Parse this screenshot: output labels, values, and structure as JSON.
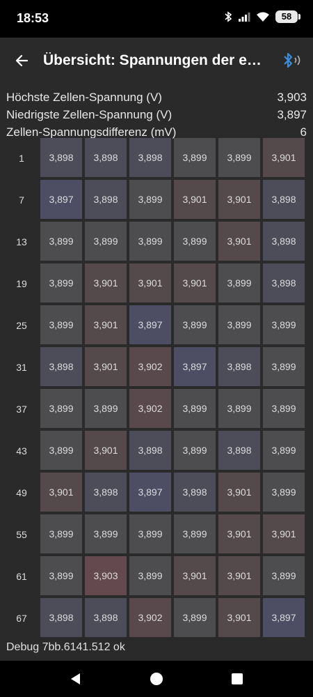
{
  "status_bar": {
    "time": "18:53",
    "battery": "58"
  },
  "app_bar": {
    "title": "Übersicht: Spannungen der e…"
  },
  "summary": [
    {
      "label": "Höchste Zellen-Spannung (V)",
      "value": "3,903"
    },
    {
      "label": "Niedrigste Zellen-Spannung (V)",
      "value": "3,897"
    },
    {
      "label": "Zellen-Spannungsdifferenz (mV)",
      "value": "6"
    }
  ],
  "grid": [
    {
      "label": "1",
      "cells": [
        "3,898",
        "3,898",
        "3,898",
        "3,899",
        "3,899",
        "3,901"
      ]
    },
    {
      "label": "7",
      "cells": [
        "3,897",
        "3,898",
        "3,899",
        "3,901",
        "3,901",
        "3,898"
      ]
    },
    {
      "label": "13",
      "cells": [
        "3,899",
        "3,899",
        "3,899",
        "3,899",
        "3,901",
        "3,898"
      ]
    },
    {
      "label": "19",
      "cells": [
        "3,899",
        "3,901",
        "3,901",
        "3,901",
        "3,899",
        "3,898"
      ]
    },
    {
      "label": "25",
      "cells": [
        "3,899",
        "3,901",
        "3,897",
        "3,899",
        "3,899",
        "3,899"
      ]
    },
    {
      "label": "31",
      "cells": [
        "3,898",
        "3,901",
        "3,902",
        "3,897",
        "3,898",
        "3,899"
      ]
    },
    {
      "label": "37",
      "cells": [
        "3,899",
        "3,899",
        "3,902",
        "3,899",
        "3,899",
        "3,899"
      ]
    },
    {
      "label": "43",
      "cells": [
        "3,899",
        "3,901",
        "3,898",
        "3,899",
        "3,898",
        "3,899"
      ]
    },
    {
      "label": "49",
      "cells": [
        "3,901",
        "3,898",
        "3,897",
        "3,898",
        "3,901",
        "3,899"
      ]
    },
    {
      "label": "55",
      "cells": [
        "3,899",
        "3,899",
        "3,899",
        "3,899",
        "3,901",
        "3,901"
      ]
    },
    {
      "label": "61",
      "cells": [
        "3,899",
        "3,903",
        "3,899",
        "3,901",
        "3,901",
        "3,899"
      ]
    },
    {
      "label": "67",
      "cells": [
        "3,898",
        "3,898",
        "3,902",
        "3,899",
        "3,901",
        "3,897"
      ]
    }
  ],
  "cell_colors": {
    "3,897": "#4d4e63",
    "3,898": "#4c4d59",
    "3,899": "#4d4d4f",
    "3,901": "#544a4c",
    "3,902": "#5a494c",
    "3,903": "#64494e"
  },
  "footer": {
    "debug": "Debug 7bb.6141.512 ok"
  },
  "colors": {
    "app_bar": "#2a2a2a",
    "background": "#2a2a2a",
    "accent_bluetooth": "#3d8ddf"
  },
  "icons": {
    "back": "arrow-left-icon",
    "bluetooth": "bluetooth-connected-icon",
    "nav_back": "triangle-back-icon",
    "nav_home": "circle-home-icon",
    "nav_recents": "square-recents-icon"
  }
}
